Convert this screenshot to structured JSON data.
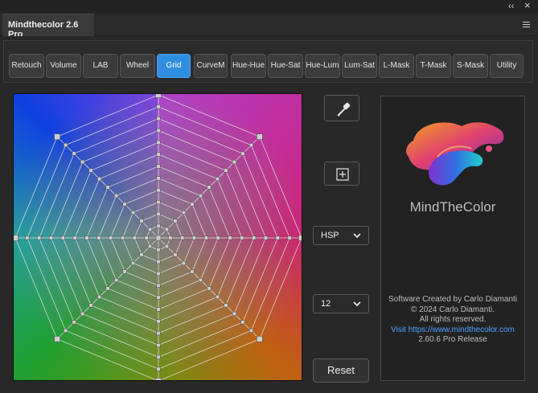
{
  "window": {
    "title": "Mindthecolor 2.6 Pro",
    "collapse_glyph": "‹‹",
    "close_glyph": "×"
  },
  "toolbar": {
    "buttons": [
      {
        "label": "Retouch",
        "active": false
      },
      {
        "label": "Volume",
        "active": false
      },
      {
        "label": "LAB",
        "active": false
      },
      {
        "label": "Wheel",
        "active": false
      },
      {
        "label": "Grid",
        "active": true
      },
      {
        "label": "CurveM",
        "active": false
      },
      {
        "label": "Hue-Hue",
        "active": false
      },
      {
        "label": "Hue-Sat",
        "active": false
      },
      {
        "label": "Hue-Lum",
        "active": false
      },
      {
        "label": "Lum-Sat",
        "active": false
      },
      {
        "label": "L-Mask",
        "active": false
      },
      {
        "label": "T-Mask",
        "active": false
      },
      {
        "label": "S-Mask",
        "active": false
      },
      {
        "label": "Utility",
        "active": false
      }
    ],
    "accent_color": "#2f8ee0"
  },
  "grid_editor": {
    "spokes": 8,
    "rings": 12
  },
  "tools": {
    "eyedropper_icon": "eyedropper-icon",
    "add_point_icon": "plus-square-icon",
    "color_model": "HSP",
    "grid_size": "12",
    "reset_label": "Reset"
  },
  "info": {
    "brand_name": "MindTheColor",
    "credit_line_1": "Software Created by Carlo Diamanti",
    "credit_line_2": "© 2024 Carlo Diamanti.",
    "credit_line_3": "All rights reserved.",
    "website_text": "Visit https://www.mindthecolor.com",
    "release": "2.60.6 Pro Release",
    "link_color": "#4aa3ff"
  }
}
